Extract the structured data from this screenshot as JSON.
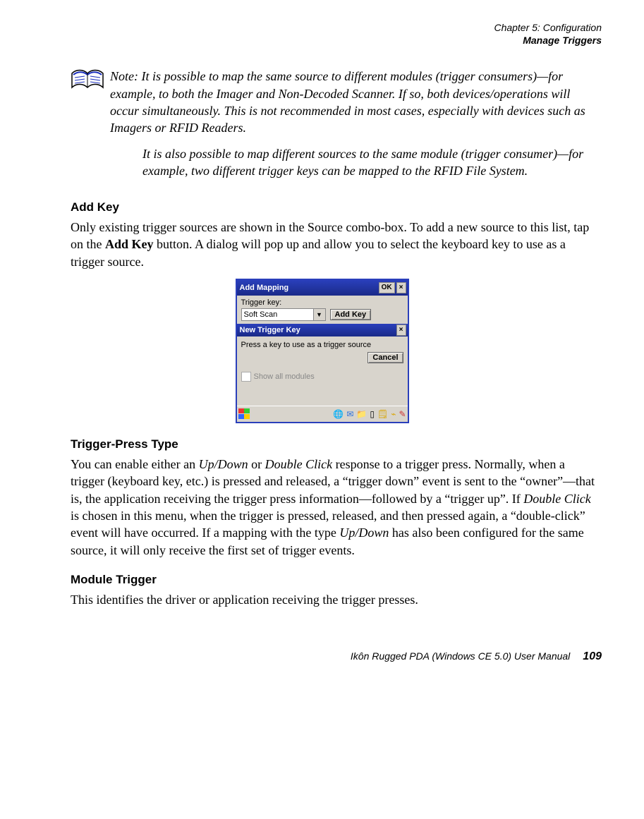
{
  "header": {
    "line1": "Chapter 5: Configuration",
    "line2": "Manage Triggers"
  },
  "note": {
    "label": "Note:",
    "p1": "It is possible to map the same source to different modules (trigger consumers)—for example, to both the Imager and Non-Decoded Scanner. If so, both devices/operations will occur simultaneously. This is not recommended in most cases, especially with devices such as Imagers or RFID Readers.",
    "p2": "It is also possible to map different sources to the same module (trigger consumer)—for example, two different trigger keys can be mapped to the RFID File System."
  },
  "sections": {
    "addkey": {
      "heading": "Add Key",
      "body_pre": "Only existing trigger sources are shown in the Source combo-box. To add a new source to this list, tap on the ",
      "body_bold": "Add Key",
      "body_post": " button. A dialog will pop up and allow you to select the keyboard key to use as a trigger source."
    },
    "triggerpress": {
      "heading": "Trigger-Press Type",
      "p_a": "You can enable either an ",
      "p_i1": "Up/Down",
      "p_b": " or ",
      "p_i2": "Double Click",
      "p_c": " response to a trigger press. Normally, when a trigger (keyboard key, etc.) is pressed and released, a “trigger down” event is sent to the “owner”—that is, the application receiving the trigger press information—followed by a “trigger up”. If ",
      "p_i3": "Double Click",
      "p_d": " is chosen in this menu, when the trigger is pressed, released, and then pressed again, a “double-click” event will have occurred. If a mapping with the type ",
      "p_i4": "Up/Down",
      "p_e": " has also been configured for the same source, it will only receive the first set of trigger events."
    },
    "moduletrigger": {
      "heading": "Module Trigger",
      "body": "This identifies the driver or application receiving the trigger presses."
    }
  },
  "dialog": {
    "outer_title": "Add Mapping",
    "ok": "OK",
    "close": "×",
    "trigger_key_label": "Trigger key:",
    "combo_value": "Soft Scan",
    "add_key_btn": "Add Key",
    "inner_title": "New Trigger Key",
    "inner_prompt": "Press a key to use as a trigger source",
    "cancel": "Cancel",
    "show_all": "Show all modules"
  },
  "footer": {
    "text": "Ikôn Rugged PDA (Windows CE 5.0) User Manual",
    "page": "109"
  }
}
